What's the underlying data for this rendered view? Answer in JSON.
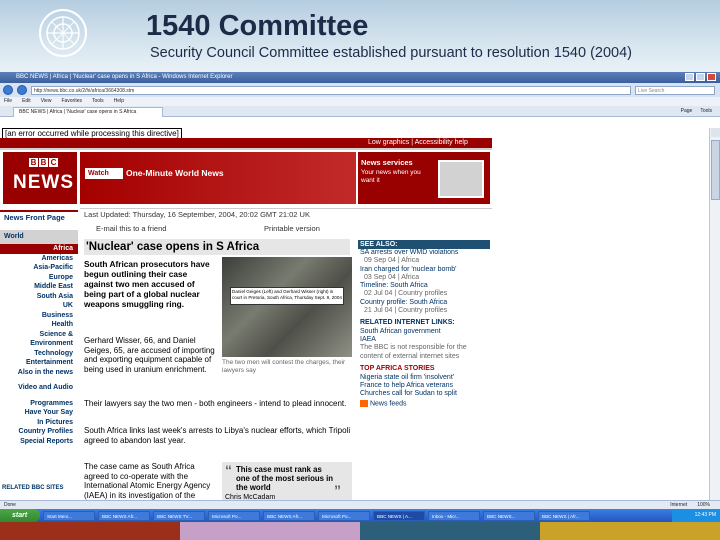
{
  "slide": {
    "title": "1540 Committee",
    "subtitle": "Security Council Committee established pursuant to resolution 1540 (2004)"
  },
  "ie": {
    "title": "BBC NEWS | Africa | 'Nuclear' case opens in S Africa - Windows Internet Explorer",
    "address": "http://news.bbc.co.uk/2/hi/africa/3664308.stm",
    "search_placeholder": "Live Search",
    "menu": [
      "File",
      "Edit",
      "View",
      "Favorites",
      "Tools",
      "Help"
    ],
    "tab": "BBC NEWS | Africa | 'Nuclear' case opens in S Africa",
    "tab_tools": [
      "Page",
      "Tools"
    ],
    "error": "[an error occurred while processing this directive]",
    "status_left": "Done",
    "status_zone": "Internet",
    "zoom": "100%"
  },
  "bbc": {
    "top_links": "Low graphics | Accessibility help",
    "logo_letters": [
      "B",
      "B",
      "C"
    ],
    "logo_text": "NEWS",
    "watch_label": "Watch",
    "banner_text": "One-Minute World News",
    "services_title": "News services",
    "services_text": "Your news when you want it",
    "nav_front": "News Front Page",
    "nav_world": "World",
    "nav_items": [
      "Africa",
      "Americas",
      "Asia-Pacific",
      "Europe",
      "Middle East",
      "South Asia",
      "UK",
      "Business",
      "Health",
      "Science & Environment",
      "Technology",
      "Entertainment",
      "Also in the news",
      "",
      "Video and Audio",
      "",
      "Programmes",
      "Have Your Say",
      "In Pictures",
      "Country Profiles",
      "Special Reports"
    ],
    "related_sites": "RELATED BBC SITES",
    "updated": "Last Updated: Thursday, 16 September, 2004, 20:02 GMT 21:02 UK",
    "email_link": "E-mail this to a friend",
    "print_link": "Printable version",
    "headline": "'Nuclear' case opens in S Africa",
    "intro": "South African prosecutors have begun outlining their case against two men accused of being part of a global nuclear weapons smuggling ring.",
    "para1": "Gerhard Wisser, 66, and Daniel Geiges, 65, are accused of importing and exporting equipment capable of being used in uranium enrichment.",
    "para2": "Their lawyers say the two men - both engineers - intend to plead innocent.",
    "para3": "South Africa links last week's arrests to Libya's nuclear efforts, which Tripoli agreed to abandon last year.",
    "para4": "The case came as South Africa agreed to co-operate with the International Atomic Energy Agency (IAEA) in its investigation of the activities",
    "photo_overlay": "Daniel Geiges (Left) and Gerhard Wisser (right) in court in Pretoria, South Africa, Thursday Sept. 9, 2004",
    "photo_caption": "The two men will contest the charges, their lawyers say",
    "quote": "This case must rank as one of the most serious in the world",
    "quote_author": "Chris McCadam",
    "see_also_title": "SEE ALSO:",
    "see_also": [
      {
        "link": "SA arrests over WMD violations",
        "date": "09 Sep 04 | Africa"
      },
      {
        "link": "Iran charged for 'nuclear bomb'",
        "date": "03 Sep 04 | Africa"
      },
      {
        "link": "Timeline: South Africa",
        "date": "02 Jul 04 | Country profiles"
      },
      {
        "link": "Country profile: South Africa",
        "date": "21 Jul 04 | Country profiles"
      }
    ],
    "related_links_title": "RELATED INTERNET LINKS:",
    "related_links": [
      "South African government",
      "IAEA"
    ],
    "disclaimer": "The BBC is not responsible for the content of external internet sites",
    "top_stories_title": "TOP AFRICA STORIES",
    "top_stories": [
      "Nigeria state oil firm 'insolvent'",
      "France to help Africa veterans",
      "Churches call for Sudan to split"
    ],
    "news_feeds": "News feeds"
  },
  "taskbar": {
    "start": "start",
    "tasks": [
      "Start Meni...",
      "BBC NEWS Afr...",
      "BBC NEWS TV...",
      "Microsoft Po...",
      "BBC NEWS Afr...",
      "Microsoft Po...",
      "BBC NEWS | A...",
      "Inbox - Micr...",
      "BBC NEWS...",
      "BBC NEWS | Afr..."
    ],
    "clock": "12:43 PM"
  },
  "footer_colors": [
    "#9b2f1a",
    "#c7a0c8",
    "#2d5f7a",
    "#c9a227",
    "#2e6b3e"
  ]
}
